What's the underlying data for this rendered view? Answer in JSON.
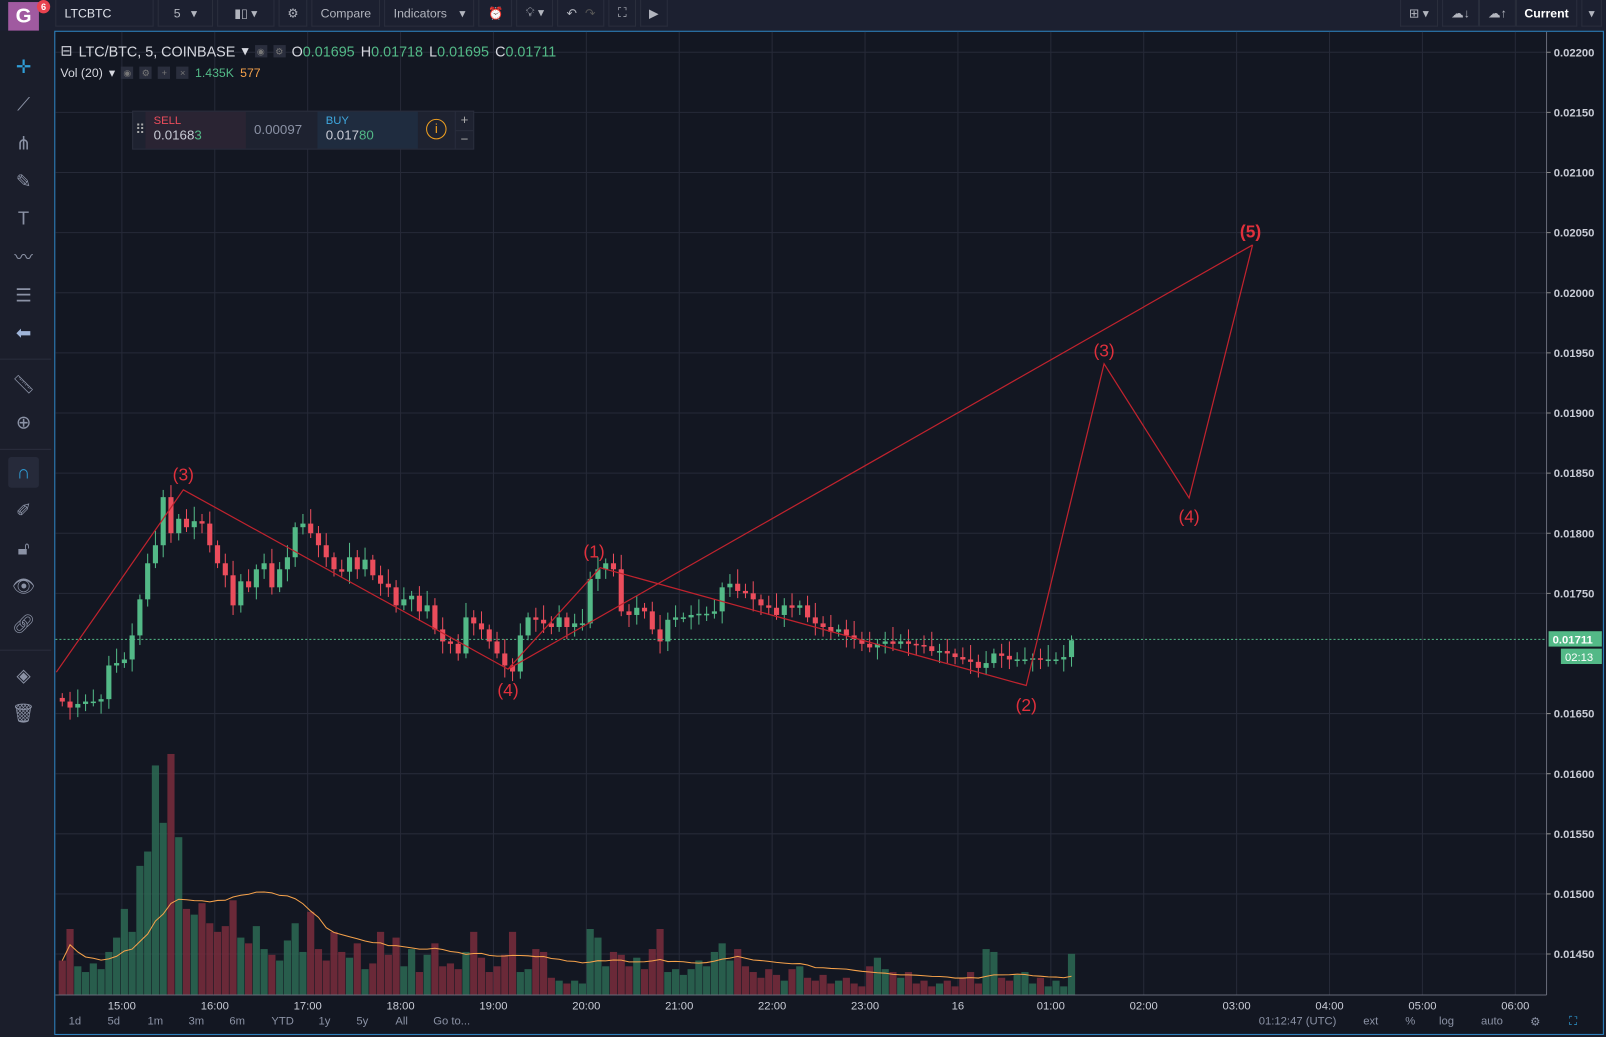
{
  "toolbar": {
    "symbol": "LTCBTC",
    "interval": "5",
    "compare": "Compare",
    "indicators": "Indicators",
    "current": "Current",
    "notifications": "6",
    "logo": "G"
  },
  "legend": {
    "title": "LTC/BTC, 5, COINBASE",
    "o_label": "O",
    "o": "0.01695",
    "h_label": "H",
    "h": "0.01718",
    "l_label": "L",
    "l": "0.01695",
    "c_label": "C",
    "c": "0.01711",
    "vol_label": "Vol (20)",
    "vol": "1.435K",
    "vol_ma": "577"
  },
  "trade": {
    "sell_label": "SELL",
    "sell_main": "0.0168",
    "sell_tail": "3",
    "spread": "0.00097",
    "buy_label": "BUY",
    "buy_main": "0.017",
    "buy_tail": "80",
    "plus": "+",
    "minus": "−"
  },
  "price_axis": {
    "ticks": [
      "0.02200",
      "0.02150",
      "0.02100",
      "0.02050",
      "0.02000",
      "0.01950",
      "0.01900",
      "0.01850",
      "0.01800",
      "0.01750",
      "0.01650",
      "0.01600",
      "0.01550",
      "0.01500",
      "0.01450"
    ],
    "last_price": "0.01711",
    "countdown": "02:13"
  },
  "time_axis": {
    "ticks": [
      "15:00",
      "16:00",
      "17:00",
      "18:00",
      "19:00",
      "20:00",
      "21:00",
      "22:00",
      "23:00",
      "16",
      "01:00",
      "02:00",
      "03:00",
      "04:00",
      "05:00",
      "06:00"
    ]
  },
  "waves": [
    "(3)",
    "(4)",
    "(1)",
    "(2)",
    "(3)",
    "(4)",
    "(5)"
  ],
  "bottom": {
    "ranges": [
      "1d",
      "5d",
      "1m",
      "3m",
      "6m",
      "YTD",
      "1y",
      "5y",
      "All",
      "Go to..."
    ],
    "clock": "01:12:47 (UTC)",
    "ext": "ext",
    "pct": "%",
    "log": "log",
    "auto": "auto"
  },
  "colors": {
    "up": "#53b987",
    "down": "#eb4d5c",
    "wave": "#c0232e",
    "bg": "#131722",
    "accent": "#2f86c5"
  },
  "chart_data": {
    "type": "candlestick",
    "symbol": "LTC/BTC",
    "interval_minutes": 5,
    "start": "14:20",
    "closes": [
      0.0166,
      0.01655,
      0.01658,
      0.0166,
      0.0166,
      0.01662,
      0.0169,
      0.01692,
      0.01695,
      0.01715,
      0.01745,
      0.01775,
      0.0179,
      0.0183,
      0.018,
      0.01812,
      0.01805,
      0.0181,
      0.01808,
      0.0179,
      0.01775,
      0.01765,
      0.0174,
      0.0176,
      0.01755,
      0.0177,
      0.01775,
      0.01755,
      0.0177,
      0.0178,
      0.01805,
      0.01808,
      0.018,
      0.0179,
      0.0178,
      0.0177,
      0.01768,
      0.0178,
      0.0177,
      0.01778,
      0.01765,
      0.01758,
      0.01755,
      0.0174,
      0.01745,
      0.01748,
      0.01735,
      0.0174,
      0.0172,
      0.0171,
      0.01708,
      0.017,
      0.0173,
      0.01725,
      0.0172,
      0.0171,
      0.017,
      0.0169,
      0.01685,
      0.01715,
      0.0173,
      0.01728,
      0.01725,
      0.01722,
      0.0173,
      0.01722,
      0.01725,
      0.01725,
      0.01762,
      0.0177,
      0.01775,
      0.0177,
      0.01735,
      0.01732,
      0.01738,
      0.01735,
      0.0172,
      0.0171,
      0.01728,
      0.0173,
      0.0173,
      0.01732,
      0.01733,
      0.01733,
      0.01735,
      0.01755,
      0.01758,
      0.01752,
      0.0175,
      0.01745,
      0.0174,
      0.01738,
      0.01732,
      0.0174,
      0.01738,
      0.0174,
      0.0173,
      0.01725,
      0.01722,
      0.01718,
      0.0172,
      0.01715,
      0.01712,
      0.01708,
      0.01705,
      0.01708,
      0.0171,
      0.01708,
      0.0171,
      0.01708,
      0.01707,
      0.01706,
      0.01702,
      0.01702,
      0.017,
      0.01697,
      0.01695,
      0.01693,
      0.01688,
      0.01692,
      0.017,
      0.01698,
      0.01695,
      0.01695,
      0.01695,
      0.01696,
      0.01695,
      0.01695,
      0.01695,
      0.01697,
      0.01711
    ],
    "volumes_k": [
      1.2,
      2.3,
      1.0,
      0.8,
      1.1,
      0.9,
      1.5,
      2.0,
      3.0,
      2.2,
      4.5,
      5.0,
      8.0,
      6.0,
      8.4,
      5.5,
      3.0,
      2.8,
      3.2,
      2.5,
      2.2,
      2.4,
      3.3,
      2.0,
      1.8,
      2.4,
      1.6,
      1.4,
      1.2,
      1.9,
      2.5,
      1.5,
      2.9,
      1.6,
      1.2,
      2.2,
      1.5,
      1.3,
      1.8,
      0.9,
      1.1,
      2.2,
      1.4,
      2.0,
      1.0,
      1.6,
      0.8,
      1.4,
      1.8,
      1.0,
      1.1,
      0.9,
      1.5,
      2.2,
      1.3,
      0.8,
      1.0,
      1.4,
      2.2,
      0.8,
      0.9,
      1.6,
      1.5,
      0.6,
      0.5,
      0.4,
      0.5,
      0.4,
      2.3,
      2.0,
      1.0,
      1.5,
      1.4,
      1.0,
      1.3,
      0.9,
      1.6,
      2.3,
      0.8,
      0.9,
      0.7,
      0.9,
      1.2,
      1.0,
      1.5,
      1.8,
      1.2,
      1.6,
      1.0,
      0.8,
      0.6,
      0.9,
      0.7,
      0.5,
      0.9,
      1.0,
      0.6,
      0.5,
      0.7,
      0.4,
      0.5,
      0.6,
      0.4,
      0.3,
      1.0,
      1.3,
      0.9,
      0.8,
      0.6,
      0.8,
      0.4,
      0.5,
      0.3,
      0.4,
      0.5,
      0.3,
      0.6,
      0.8,
      0.4,
      1.6,
      1.5,
      0.6,
      0.5,
      0.7,
      0.8,
      0.4,
      0.6,
      0.3,
      0.5,
      0.3,
      1.435
    ],
    "ylim": [
      0.0142,
      0.0222
    ]
  }
}
